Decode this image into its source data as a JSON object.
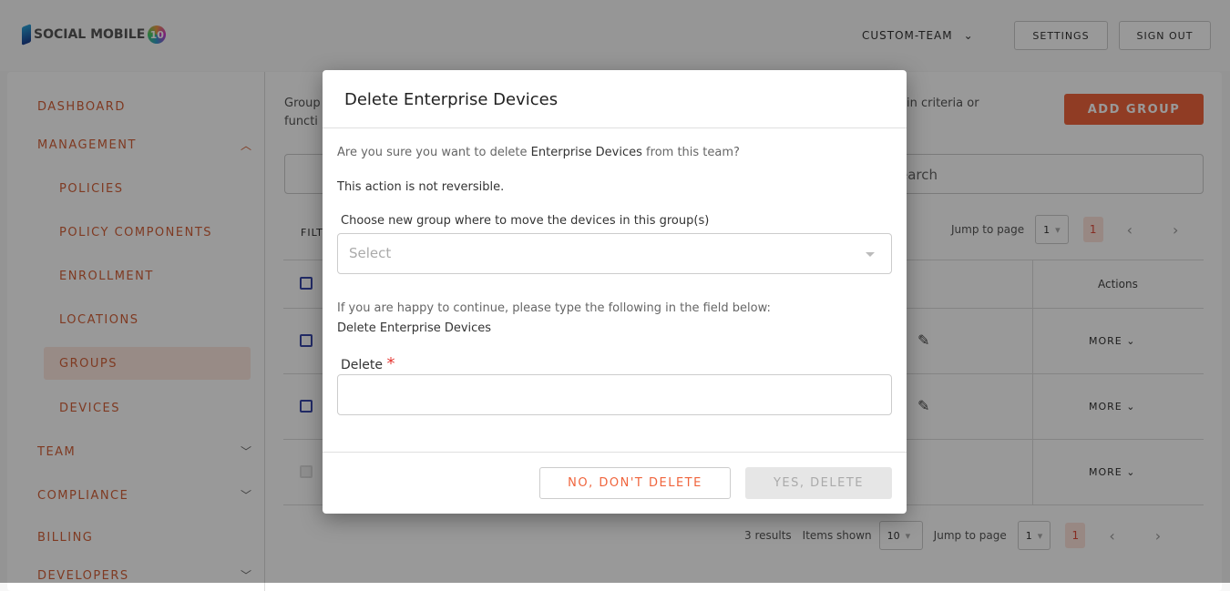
{
  "header": {
    "logo_text": "SOCIAL MOBILE",
    "logo_badge": "10",
    "team": "CUSTOM-TEAM",
    "settings": "SETTINGS",
    "sign_out": "SIGN OUT"
  },
  "sidebar": {
    "items": [
      {
        "label": "DASHBOARD"
      },
      {
        "label": "MANAGEMENT"
      },
      {
        "label": "POLICIES"
      },
      {
        "label": "POLICY COMPONENTS"
      },
      {
        "label": "ENROLLMENT"
      },
      {
        "label": "LOCATIONS"
      },
      {
        "label": "GROUPS",
        "active": true
      },
      {
        "label": "DEVICES"
      },
      {
        "label": "TEAM"
      },
      {
        "label": "COMPLIANCE"
      },
      {
        "label": "BILLING"
      },
      {
        "label": "DEVELOPERS"
      }
    ]
  },
  "main": {
    "description_start": "Group",
    "description_end": "in criteria or",
    "description_line2": "functi",
    "add_group": "ADD GROUP",
    "search_placeholder": "earch",
    "filter_label": "FILT",
    "actions_header": "Actions",
    "more": "MORE",
    "top_pager": {
      "jump_label": "Jump to page",
      "jump_value": "1",
      "page": "1"
    },
    "bottom_pager": {
      "results": "3 results",
      "items_label": "Items shown",
      "items_value": "10",
      "jump_label": "Jump to page",
      "jump_value": "1",
      "page": "1"
    }
  },
  "modal": {
    "title": "Delete Enterprise Devices",
    "q_prefix": "Are you sure you want to delete ",
    "q_name": "Enterprise Devices",
    "q_suffix": " from this team?",
    "warning": "This action is not reversible.",
    "move_label": "Choose new group where to move the devices in this group(s)",
    "select_placeholder": "Select",
    "confirm_instr": "If you are happy to continue, please type the following in the field below:",
    "confirm_phrase": "Delete Enterprise Devices",
    "delete_label": "Delete",
    "required": "*",
    "cancel": "NO, DON'T DELETE",
    "confirm": "YES, DELETE"
  },
  "colors": {
    "accent": "#f0643c",
    "required": "#e53935"
  }
}
